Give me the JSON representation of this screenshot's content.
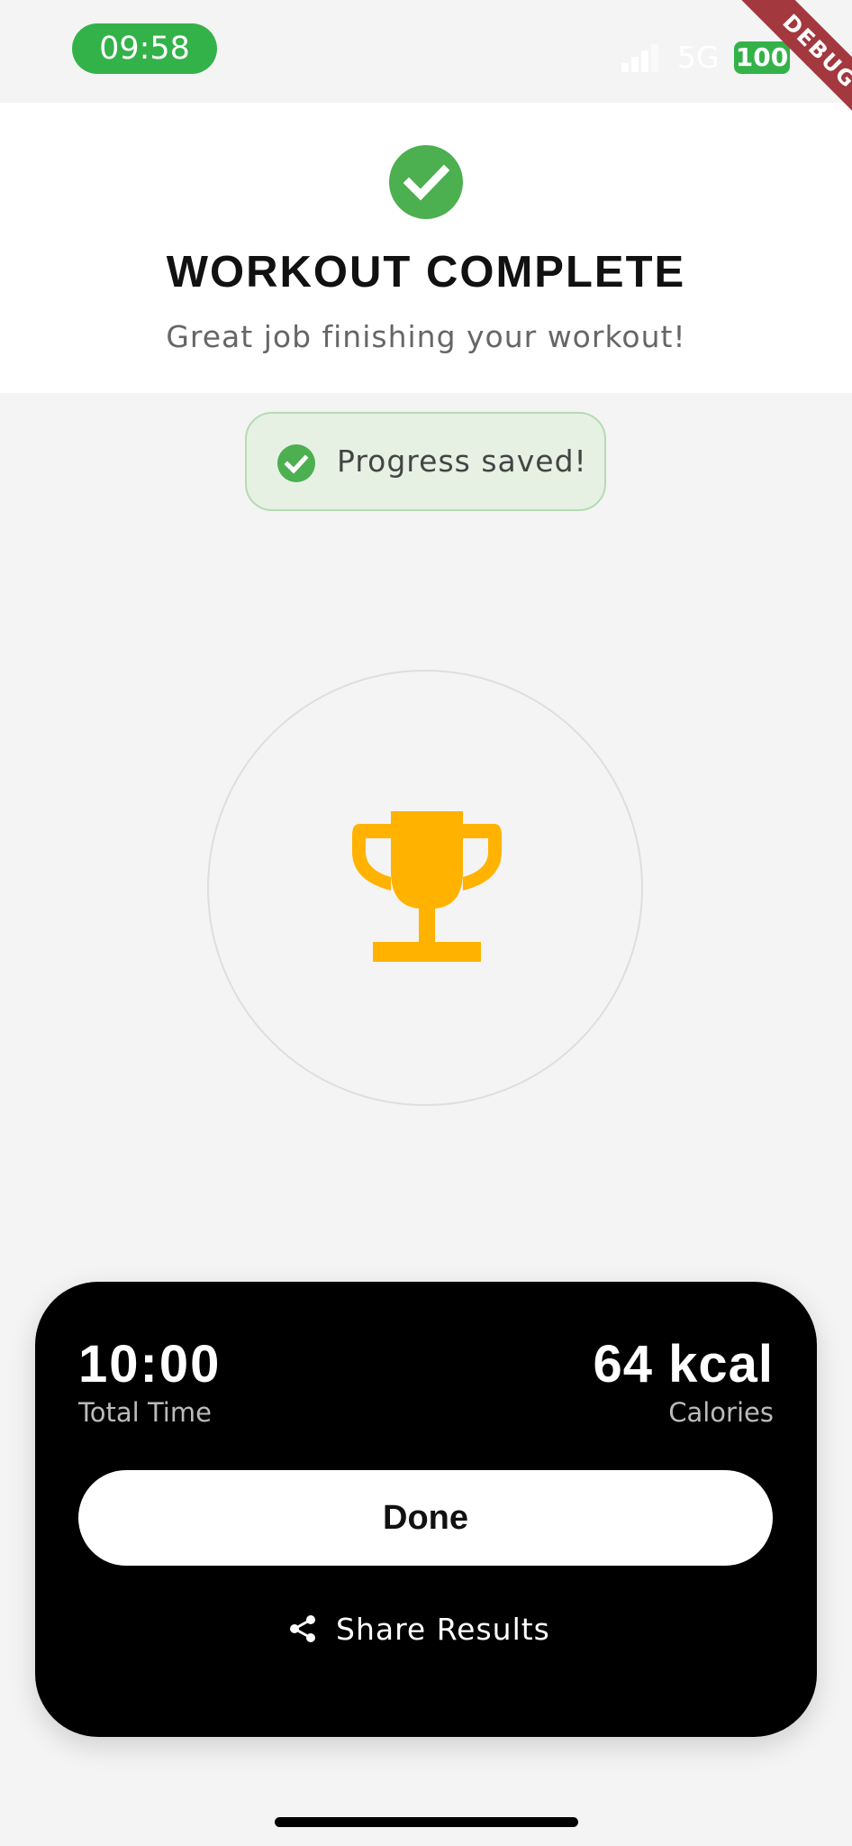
{
  "status_bar": {
    "time": "09:58",
    "network": "5G",
    "battery": "100"
  },
  "debug_banner": "DEBUG",
  "header": {
    "title": "WORKOUT COMPLETE",
    "subtitle": "Great job finishing your workout!"
  },
  "toast": {
    "message": "Progress saved!"
  },
  "summary": {
    "total_time_value": "10:00",
    "total_time_label": "Total Time",
    "calories_value": "64 kcal",
    "calories_label": "Calories",
    "done_label": "Done",
    "share_label": "Share Results"
  },
  "icons": [
    "check-circle-icon",
    "trophy-icon",
    "share-icon",
    "signal-icon"
  ],
  "colors": {
    "success": "#4caf50",
    "status_pill": "#34b24a",
    "trophy": "#ffb300",
    "panel": "#000000",
    "background": "#f4f4f4"
  }
}
